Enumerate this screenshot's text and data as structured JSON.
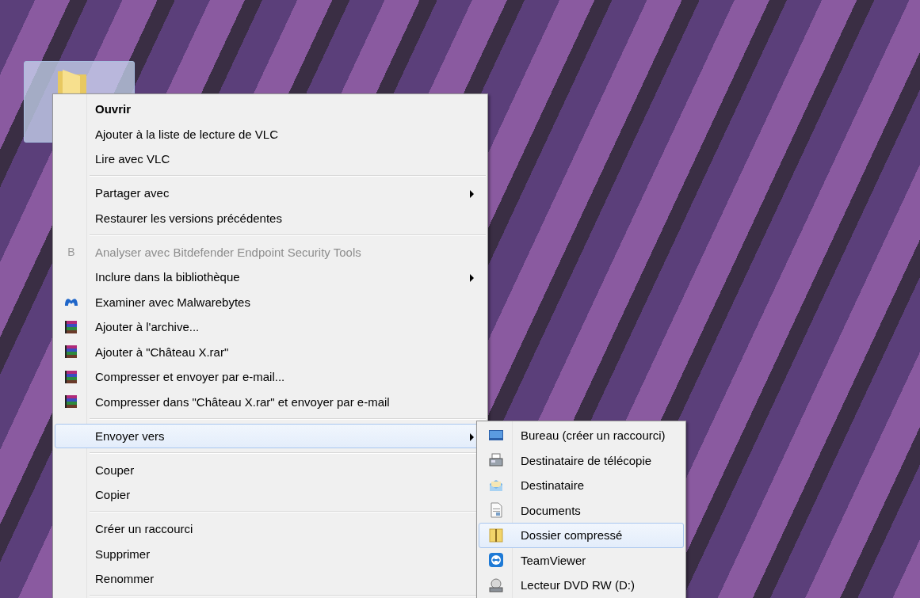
{
  "desktop": {
    "folder_icon": {
      "selected": true
    }
  },
  "context_menu": {
    "items": [
      {
        "kind": "item",
        "label": "Ouvrir",
        "bold": true,
        "disabled": false,
        "submenu": false,
        "selected": false
      },
      {
        "kind": "item",
        "label": "Ajouter à la liste de lecture de VLC",
        "bold": false,
        "disabled": false,
        "submenu": false,
        "selected": false
      },
      {
        "kind": "item",
        "label": "Lire avec VLC",
        "bold": false,
        "disabled": false,
        "submenu": false,
        "selected": false
      },
      {
        "kind": "separator"
      },
      {
        "kind": "item",
        "label": "Partager avec",
        "bold": false,
        "disabled": false,
        "submenu": true,
        "selected": false
      },
      {
        "kind": "item",
        "label": "Restaurer les versions précédentes",
        "bold": false,
        "disabled": false,
        "submenu": false,
        "selected": false
      },
      {
        "kind": "separator"
      },
      {
        "kind": "glyph",
        "glyph": "B",
        "label": "Analyser avec Bitdefender Endpoint Security Tools",
        "bold": false,
        "disabled": true,
        "submenu": false,
        "selected": false
      },
      {
        "kind": "item",
        "label": "Inclure dans la bibliothèque",
        "bold": false,
        "disabled": false,
        "submenu": true,
        "selected": false
      },
      {
        "kind": "scan",
        "label": "Examiner avec Malwarebytes",
        "bold": false,
        "disabled": false,
        "submenu": false,
        "selected": false
      },
      {
        "kind": "archive",
        "label": "Ajouter à l'archive...",
        "bold": false,
        "disabled": false,
        "submenu": false,
        "selected": false
      },
      {
        "kind": "archive",
        "label": "Ajouter à \"Château X.rar\"",
        "bold": false,
        "disabled": false,
        "submenu": false,
        "selected": false
      },
      {
        "kind": "archive",
        "label": "Compresser et envoyer par e-mail...",
        "bold": false,
        "disabled": false,
        "submenu": false,
        "selected": false
      },
      {
        "kind": "archive",
        "label": "Compresser dans \"Château X.rar\" et envoyer par e-mail",
        "bold": false,
        "disabled": false,
        "submenu": false,
        "selected": false
      },
      {
        "kind": "separator"
      },
      {
        "kind": "item",
        "label": "Envoyer vers",
        "bold": false,
        "disabled": false,
        "submenu": true,
        "selected": true
      },
      {
        "kind": "separator"
      },
      {
        "kind": "item",
        "label": "Couper",
        "bold": false,
        "disabled": false,
        "submenu": false,
        "selected": false
      },
      {
        "kind": "item",
        "label": "Copier",
        "bold": false,
        "disabled": false,
        "submenu": false,
        "selected": false
      },
      {
        "kind": "separator"
      },
      {
        "kind": "item",
        "label": "Créer un raccourci",
        "bold": false,
        "disabled": false,
        "submenu": false,
        "selected": false
      },
      {
        "kind": "item",
        "label": "Supprimer",
        "bold": false,
        "disabled": false,
        "submenu": false,
        "selected": false
      },
      {
        "kind": "item",
        "label": "Renommer",
        "bold": false,
        "disabled": false,
        "submenu": false,
        "selected": false
      },
      {
        "kind": "separator"
      }
    ]
  },
  "send_to_menu": {
    "items": [
      {
        "kind": "desktop",
        "label": "Bureau (créer un raccourci)",
        "selected": false
      },
      {
        "kind": "fax",
        "label": "Destinataire de télécopie",
        "selected": false
      },
      {
        "kind": "mail",
        "label": "Destinataire",
        "selected": false
      },
      {
        "kind": "document",
        "label": "Documents",
        "selected": false
      },
      {
        "kind": "zip",
        "label": "Dossier compressé",
        "selected": true
      },
      {
        "kind": "remote",
        "label": "TeamViewer",
        "selected": false
      },
      {
        "kind": "drive",
        "label": "Lecteur DVD RW (D:)",
        "selected": false
      }
    ]
  }
}
